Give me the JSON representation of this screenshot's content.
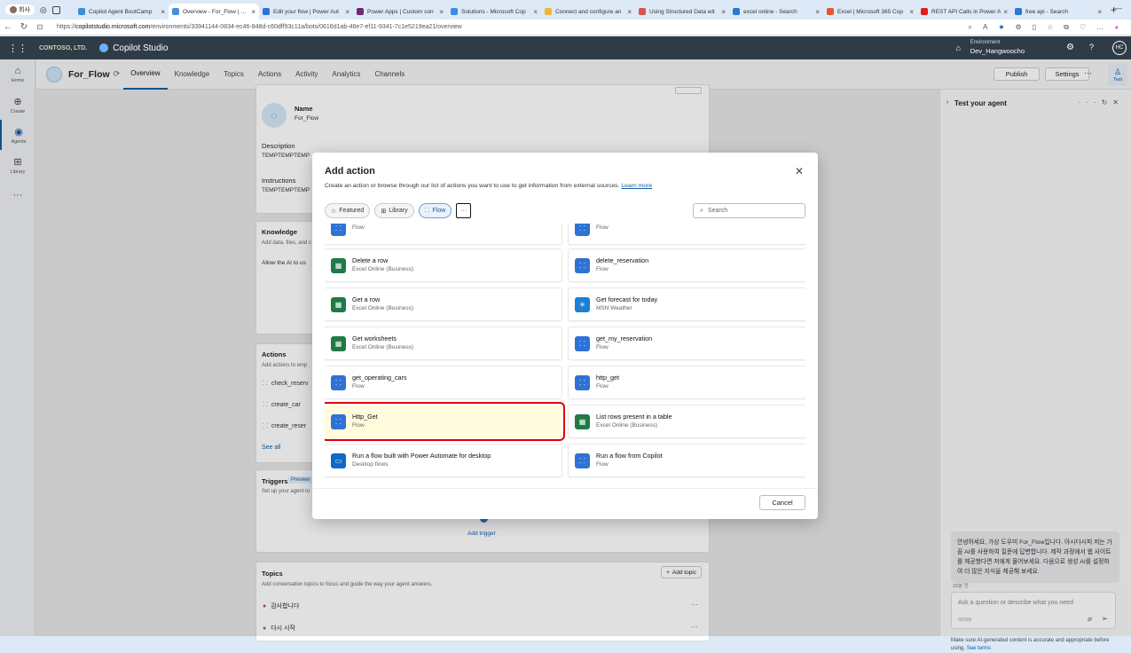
{
  "browser": {
    "profile": "회사",
    "tabs": [
      {
        "title": "Copilot Agent BootCamp",
        "color": "#3b8ee0"
      },
      {
        "title": "Overview - For_Flow | Mic",
        "color": "#4a90d9",
        "active": true
      },
      {
        "title": "Edit your flow | Power Aut",
        "color": "#2f6fd6"
      },
      {
        "title": "Power Apps | Custom con",
        "color": "#742774"
      },
      {
        "title": "Solutions - Microsoft Cop",
        "color": "#3b8ee0"
      },
      {
        "title": "Connect and configure an",
        "color": "#f2b632"
      },
      {
        "title": "Using Structured Data wit",
        "color": "#d9534f"
      },
      {
        "title": "excel online - Search",
        "color": "#2a7ad2"
      },
      {
        "title": "Excel | Microsoft 365 Cop",
        "color": "#e05a2b"
      },
      {
        "title": "REST API Calls in Power A",
        "color": "#e21b1b"
      },
      {
        "title": "free api - Search",
        "color": "#2a7ad2"
      }
    ],
    "url_prefix": "https://",
    "url_host": "copilotstudio.microsoft.com",
    "url_path": "/environments/33941144-0834-ec46-848d-c60dff93c11a/bots/0616d1ab-46e7-ef11-9341-7c1e5219ea21/overview"
  },
  "topbar": {
    "brand": "CONTOSO, LTD.",
    "product": "Copilot Studio",
    "env_label": "Environment",
    "env_value": "Dev_Hangwoocho",
    "avatar": "HC"
  },
  "rail": [
    {
      "label": "Home",
      "icon": "⌂"
    },
    {
      "label": "Create",
      "icon": "⊕"
    },
    {
      "label": "Agents",
      "icon": "◉",
      "active": true
    },
    {
      "label": "Library",
      "icon": "⊞"
    }
  ],
  "agent": {
    "name": "For_Flow",
    "tabs": [
      "Overview",
      "Knowledge",
      "Topics",
      "Actions",
      "Activity",
      "Analytics",
      "Channels"
    ],
    "publish": "Publish",
    "settings": "Settings",
    "test": "Test"
  },
  "details": {
    "name_label": "Name",
    "name_value": "For_Flow",
    "desc_label": "Description",
    "desc_value": "TEMPTEMPTEMP",
    "instr_label": "Instructions",
    "instr_value": "TEMPTEMPTEMP"
  },
  "knowledge": {
    "title": "Knowledge",
    "sub": "Add data, files, and c",
    "text": "Allow the AI to us"
  },
  "actions": {
    "title": "Actions",
    "sub": "Add actions to emp",
    "items": [
      "check_reserv",
      "create_car",
      "create_reser"
    ],
    "see_all": "See all"
  },
  "triggers": {
    "title": "Triggers",
    "badge": "Preview",
    "sub": "Set up your agent to",
    "add": "Add trigger"
  },
  "topics": {
    "title": "Topics",
    "add": "Add topic",
    "sub": "Add conversation topics to focus and guide the way your agent answers.",
    "items": [
      "감사합니다",
      "다시 시작"
    ]
  },
  "test_panel": {
    "title": "Test your agent",
    "greeting": "안녕하세요, 가상 도우미 For_Flow입니다. 아시다시피 저는 가끔 AI를 사용하여 질문에 답변합니다. 제작 과정에서 웹 사이트를 제공했다면 저에게 물어보세요. 다음으로 생성 AI를 설정하여 더 많은 지식을 제공해 보세요.",
    "timestamp": "29분 전",
    "placeholder": "Ask a question or describe what you need",
    "counter": "0/2000",
    "disclaimer": "Make sure AI-generated content is accurate and appropriate before using.",
    "terms": "See terms"
  },
  "modal": {
    "title": "Add action",
    "desc": "Create an action or browse through our list of actions you want to use to get information from external sources.",
    "learn_more": "Learn more",
    "filters": [
      "Featured",
      "Library",
      "Flow"
    ],
    "search_placeholder": "Search",
    "cancel": "Cancel",
    "items": [
      {
        "name": "",
        "sub": "Flow",
        "type": "flow"
      },
      {
        "name": "",
        "sub": "Flow",
        "type": "flow"
      },
      {
        "name": "Delete a row",
        "sub": "Excel Online (Business)",
        "type": "excel"
      },
      {
        "name": "delete_reservation",
        "sub": "Flow",
        "type": "flow"
      },
      {
        "name": "Get a row",
        "sub": "Excel Online (Business)",
        "type": "excel"
      },
      {
        "name": "Get forecast for today",
        "sub": "MSN Weather",
        "type": "msn"
      },
      {
        "name": "Get worksheets",
        "sub": "Excel Online (Business)",
        "type": "excel"
      },
      {
        "name": "get_my_reservation",
        "sub": "Flow",
        "type": "flow"
      },
      {
        "name": "get_operating_cars",
        "sub": "Flow",
        "type": "flow"
      },
      {
        "name": "http_get",
        "sub": "Flow",
        "type": "flow"
      },
      {
        "name": "Http_Get",
        "sub": "Flow",
        "type": "flow",
        "highlighted": true
      },
      {
        "name": "List rows present in a table",
        "sub": "Excel Online (Business)",
        "type": "excel"
      },
      {
        "name": "Run a flow built with Power Automate for desktop",
        "sub": "Desktop flows",
        "type": "desk"
      },
      {
        "name": "Run a flow from Copilot",
        "sub": "Flow",
        "type": "flow"
      }
    ]
  }
}
